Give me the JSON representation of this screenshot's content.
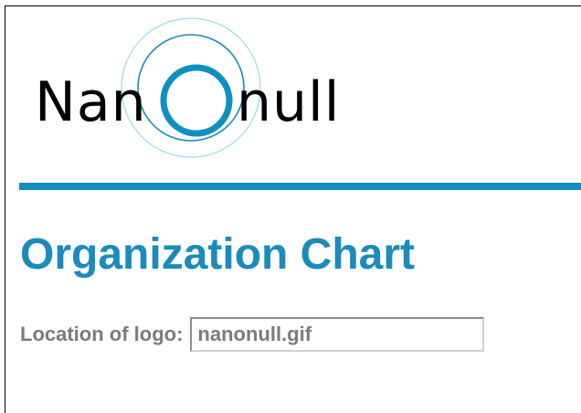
{
  "brand": {
    "logo_text_left": "Nan",
    "logo_text_right": "null",
    "accent": "#0f8fbf",
    "title_color": "#1a8bbb",
    "label_color": "#7b7b7b"
  },
  "page": {
    "title": "Organization Chart"
  },
  "form": {
    "logo_location_label": "Location of logo:",
    "logo_location_value": "nanonull.gif"
  }
}
